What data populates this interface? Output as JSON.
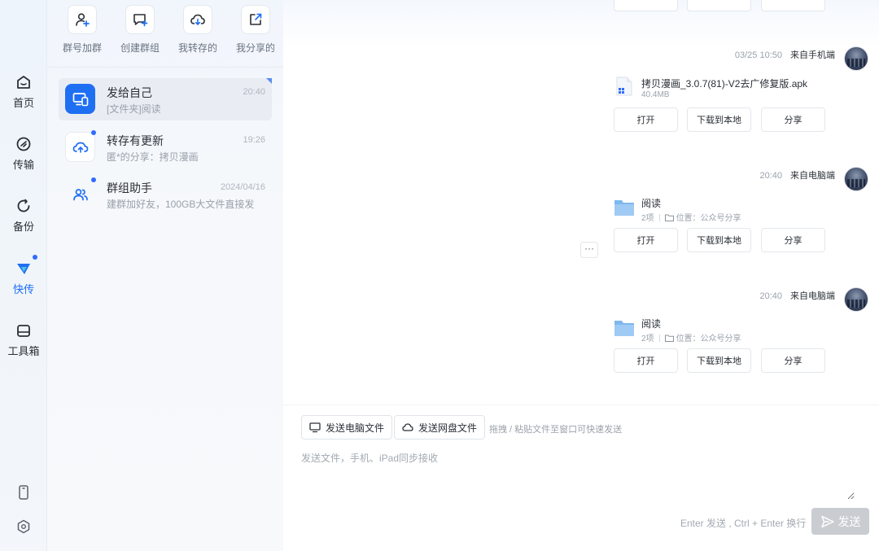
{
  "nav": {
    "items": [
      {
        "label": "首页",
        "icon": "home-icon"
      },
      {
        "label": "传输",
        "icon": "transfer-icon"
      },
      {
        "label": "备份",
        "icon": "backup-icon"
      },
      {
        "label": "快传",
        "icon": "quick-send-icon"
      },
      {
        "label": "工具箱",
        "icon": "toolbox-icon"
      }
    ],
    "bottom_icons": [
      "phone-icon",
      "settings-icon"
    ]
  },
  "quick_actions": [
    {
      "label": "群号加群",
      "icon": "join-group-icon"
    },
    {
      "label": "创建群组",
      "icon": "create-group-icon"
    },
    {
      "label": "我转存的",
      "icon": "cloud-saved-icon"
    },
    {
      "label": "我分享的",
      "icon": "share-out-icon"
    }
  ],
  "conversations": [
    {
      "title": "发给自己",
      "subtitle": "[文件夹]阅读",
      "time": "20:40"
    },
    {
      "title": "转存有更新",
      "subtitle": "匿*的分享：拷贝漫画",
      "time": "19:26"
    },
    {
      "title": "群组助手",
      "subtitle": "建群加好友，100GB大文件直接发",
      "time": "2024/04/16"
    }
  ],
  "messages": [
    {
      "time": "03/25 10:50",
      "source": "来自手机端",
      "file_name": "拷贝漫画_3.0.7(81)-V2去广修复版.apk",
      "file_size": "40.4MB",
      "file_icon": "apk-file-icon"
    },
    {
      "time": "20:40",
      "source": "来自电脑端",
      "file_name": "阅读",
      "item_count": "2项",
      "location": "位置：公众号分享",
      "file_icon": "folder-icon"
    },
    {
      "time": "20:40",
      "source": "来自电脑端",
      "file_name": "阅读",
      "item_count": "2项",
      "location": "位置：公众号分享",
      "file_icon": "folder-icon"
    }
  ],
  "card_actions": {
    "open": "打开",
    "download": "下载到本地",
    "share": "分享"
  },
  "more_label": "···",
  "composer": {
    "send_pc_file": "发送电脑文件",
    "send_cloud_file": "发送网盘文件",
    "drop_hint": "拖拽 / 粘贴文件至窗口可快速发送",
    "placeholder": "发送文件，手机、iPad同步接收",
    "send_hint": "Enter 发送 , Ctrl + Enter 换行",
    "send_label": "发送"
  },
  "colors": {
    "accent": "#1f6ff3",
    "badge": "#2f6bff",
    "folder": "#7fb8ee",
    "send_disabled": "#c9ccd1"
  }
}
